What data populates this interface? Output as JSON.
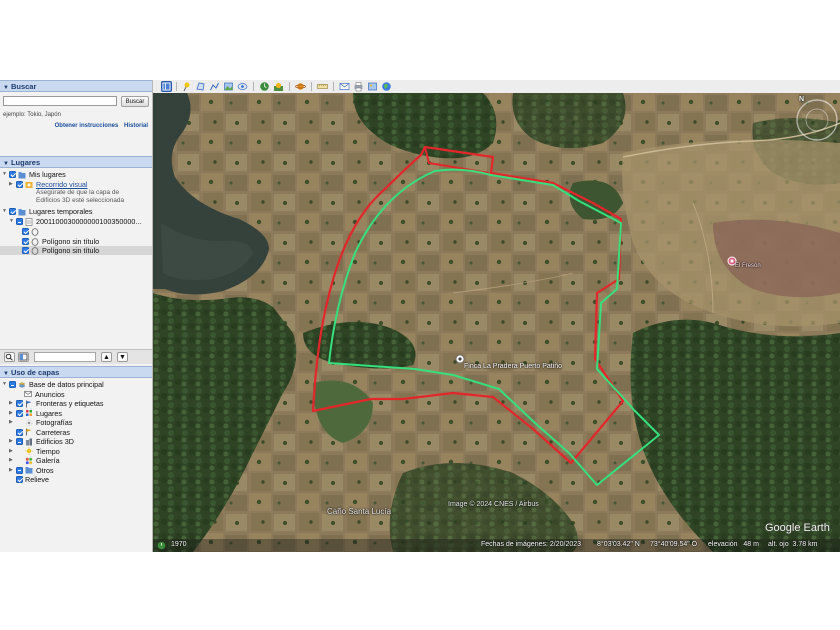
{
  "search": {
    "header": "Buscar",
    "input_value": "",
    "button_label": "Buscar",
    "example": "ejemplo: Tokio, Japón",
    "link_directions": "Obtener instrucciones",
    "link_history": "Historial"
  },
  "places": {
    "header": "Lugares",
    "my_places": "Mis lugares",
    "tour": "Recorrido visual",
    "tour_note_1": "Asegúrate de que la capa de",
    "tour_note_2": "Edificios 3D esté seleccionada",
    "temp_places": "Lugares temporales",
    "kml_file": "2001100030000000100350000...",
    "polygon_1": "Polígono sin título",
    "polygon_2": "Polígono sin título"
  },
  "layers": {
    "header": "Uso de capas",
    "items": [
      {
        "label": "Base de datos principal",
        "icon": "globe-stack-icon"
      },
      {
        "label": "Anuncios",
        "icon": "mail-icon"
      },
      {
        "label": "Fronteras y etiquetas",
        "icon": "flag-icon"
      },
      {
        "label": "Lugares",
        "icon": "places-icon"
      },
      {
        "label": "Fotografías",
        "icon": "photo-icon"
      },
      {
        "label": "Carreteras",
        "icon": "road-icon"
      },
      {
        "label": "Edificios 3D",
        "icon": "building-icon"
      },
      {
        "label": "Tiempo",
        "icon": "weather-icon"
      },
      {
        "label": "Galería",
        "icon": "gallery-icon"
      },
      {
        "label": "Otros",
        "icon": "folder-icon"
      },
      {
        "label": "Relieve",
        "icon": ""
      }
    ]
  },
  "map": {
    "pin_label": "Finca La Pradera Puerto Patiño",
    "poi_label": "El Fresón",
    "water_label": "Caño Santa Lucía",
    "copyright": "Image © 2024 CNES / Airbus",
    "brand": "Google Earth",
    "year": "1970",
    "compass": "N"
  },
  "status": {
    "imagery_date": "Fechas de imágenes: 2/20/2023",
    "lat": "8°03'03.42\" N",
    "lon": "73°40'09.54\" O",
    "elevation": "elevación   48 m",
    "eye_alt": "alt. ojo  3.78 km"
  },
  "colors": {
    "boundary_red": "#e3262a",
    "boundary_green": "#35e07d",
    "panel_header": "#c9daf0"
  }
}
